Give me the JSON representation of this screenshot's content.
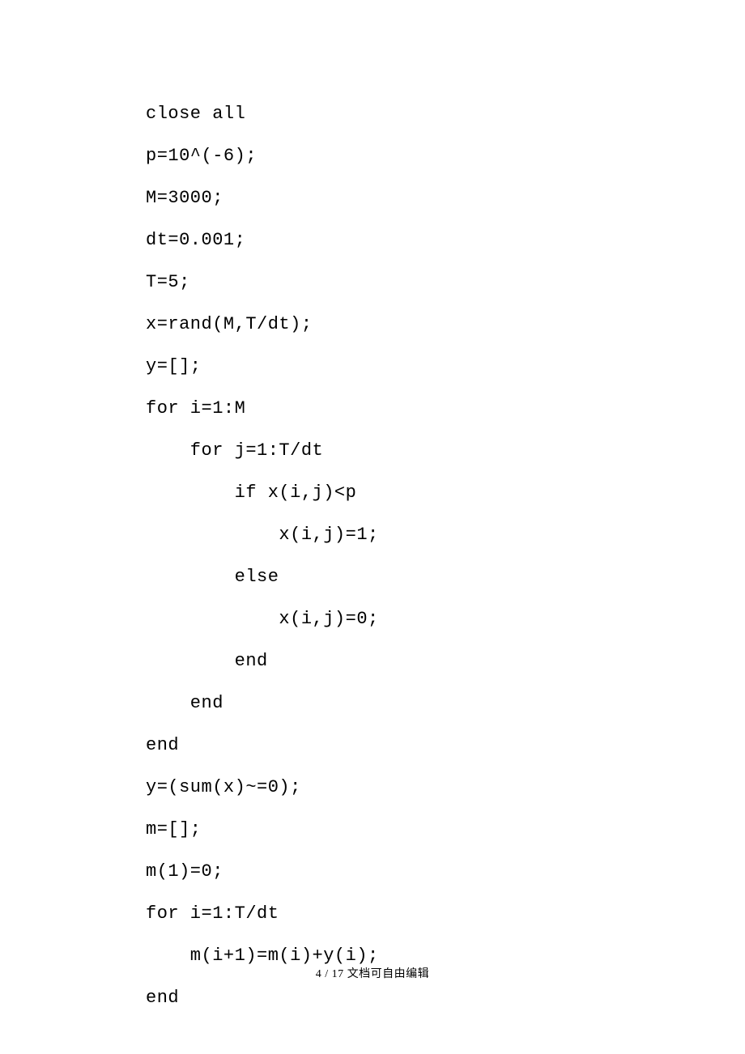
{
  "code": {
    "lines": [
      "close all",
      "p=10^(-6);",
      "M=3000;",
      "dt=0.001;",
      "T=5;",
      "x=rand(M,T/dt);",
      "y=[];",
      "for i=1:M",
      "    for j=1:T/dt",
      "        if x(i,j)<p",
      "            x(i,j)=1;",
      "        else",
      "            x(i,j)=0;",
      "        end",
      "    end",
      "end",
      "y=(sum(x)~=0);",
      "m=[];",
      "m(1)=0;",
      "for i=1:T/dt",
      "    m(i+1)=m(i)+y(i);",
      "end"
    ]
  },
  "footer": {
    "page": "4 / 17",
    "note": "文档可自由编辑"
  }
}
